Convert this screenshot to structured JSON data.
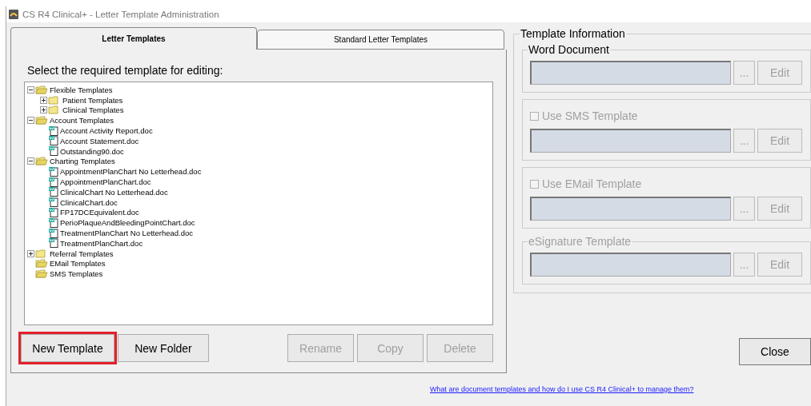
{
  "window": {
    "title": "CS R4 Clinical+ - Letter Template Administration"
  },
  "tabs": [
    {
      "label": "Letter Templates",
      "selected": true
    },
    {
      "label": "Standard Letter Templates",
      "selected": false
    }
  ],
  "prompt": "Select the required template for editing:",
  "tree": [
    {
      "kind": "folder",
      "label": "Flexible Templates",
      "expanded": true,
      "children": [
        {
          "kind": "folder",
          "label": "Patient Templates",
          "expanded": false
        },
        {
          "kind": "folder",
          "label": "Clinical Templates",
          "expanded": false
        }
      ]
    },
    {
      "kind": "folder",
      "label": "Account Templates",
      "expanded": true,
      "children": [
        {
          "kind": "document",
          "label": "Account Activity Report.doc"
        },
        {
          "kind": "document",
          "label": "Account Statement.doc"
        },
        {
          "kind": "document",
          "label": "Outstanding90.doc"
        }
      ]
    },
    {
      "kind": "folder",
      "label": "Charting Templates",
      "expanded": true,
      "children": [
        {
          "kind": "document",
          "label": "AppointmentPlanChart No Letterhead.doc"
        },
        {
          "kind": "document",
          "label": "AppointmentPlanChart.doc"
        },
        {
          "kind": "document",
          "label": "ClinicalChart No Letterhead.doc"
        },
        {
          "kind": "document",
          "label": "ClinicalChart.doc"
        },
        {
          "kind": "document",
          "label": "FP17DCEquivalent.doc"
        },
        {
          "kind": "document",
          "label": "PerioPlaqueAndBleedingPointChart.doc"
        },
        {
          "kind": "document",
          "label": "TreatmentPlanChart No Letterhead.doc"
        },
        {
          "kind": "document",
          "label": "TreatmentPlanChart.doc"
        }
      ]
    },
    {
      "kind": "folder",
      "label": "Referral Templates",
      "expanded": false
    },
    {
      "kind": "empty-folder",
      "label": "EMail Templates"
    },
    {
      "kind": "empty-folder",
      "label": "SMS Templates"
    }
  ],
  "left_buttons": [
    {
      "label": "New Template",
      "disabled": false,
      "highlighted": true
    },
    {
      "label": "New Folder",
      "disabled": false,
      "highlighted": false
    }
  ],
  "right_buttons": [
    {
      "label": "Rename",
      "disabled": true,
      "highlighted": false
    },
    {
      "label": "Copy",
      "disabled": true,
      "highlighted": false
    },
    {
      "label": "Delete",
      "disabled": true,
      "highlighted": false
    }
  ],
  "template_information": {
    "title": "Template Information",
    "sections": [
      {
        "kind": "group",
        "title": "Word Document",
        "disabled": false,
        "browse": "...",
        "edit": "Edit",
        "edit_disabled": true
      },
      {
        "kind": "checkbox",
        "title": "Use SMS Template",
        "checked": false,
        "disabled": true,
        "browse": "...",
        "edit": "Edit",
        "edit_disabled": true
      },
      {
        "kind": "checkbox",
        "title": "Use EMail Template",
        "checked": false,
        "disabled": true,
        "browse": "...",
        "edit": "Edit",
        "edit_disabled": true
      },
      {
        "kind": "group",
        "title": "eSignature Template",
        "disabled": true,
        "browse": "...",
        "edit": "Edit",
        "edit_disabled": true
      }
    ]
  },
  "close_button": "Close",
  "help_link": "What are document templates and how do I use CS R4 Clinical+ to manage them?"
}
